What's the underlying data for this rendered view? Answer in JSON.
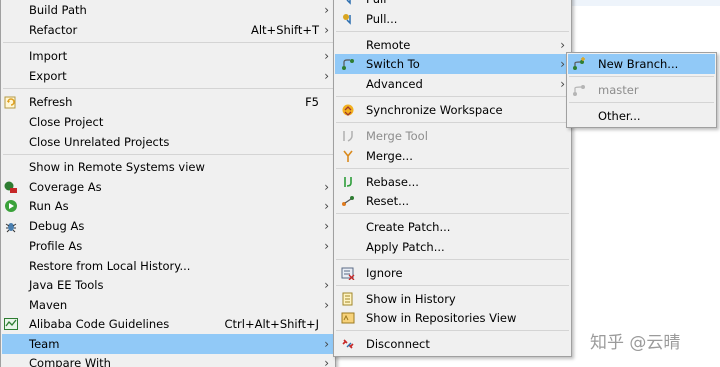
{
  "main_menu": {
    "items": [
      {
        "label": "Build Path",
        "submenu": true
      },
      {
        "label": "Refactor",
        "shortcut": "Alt+Shift+T",
        "submenu": true
      },
      {
        "label": "Import",
        "submenu": true
      },
      {
        "label": "Export",
        "submenu": true
      },
      {
        "label": "Refresh",
        "shortcut": "F5",
        "icon": "refresh-icon"
      },
      {
        "label": "Close Project"
      },
      {
        "label": "Close Unrelated Projects"
      },
      {
        "label": "Show in Remote Systems view"
      },
      {
        "label": "Coverage As",
        "submenu": true,
        "icon": "coverage-icon"
      },
      {
        "label": "Run As",
        "submenu": true,
        "icon": "run-icon"
      },
      {
        "label": "Debug As",
        "submenu": true,
        "icon": "debug-icon"
      },
      {
        "label": "Profile As",
        "submenu": true
      },
      {
        "label": "Restore from Local History..."
      },
      {
        "label": "Java EE Tools",
        "submenu": true
      },
      {
        "label": "Maven",
        "submenu": true
      },
      {
        "label": "Alibaba Code Guidelines",
        "shortcut": "Ctrl+Alt+Shift+J",
        "icon": "alibaba-guidelines-icon"
      },
      {
        "label": "Team",
        "submenu": true,
        "highlighted": true
      },
      {
        "label": "Compare With",
        "submenu": true
      }
    ]
  },
  "team_menu": {
    "items": [
      {
        "label": "Pull",
        "icon": "git-pull-icon"
      },
      {
        "label": "Pull...",
        "icon": "git-pull-dialog-icon"
      },
      {
        "label": "Remote",
        "submenu": true
      },
      {
        "label": "Switch To",
        "submenu": true,
        "highlighted": true,
        "icon": "switch-branch-icon"
      },
      {
        "label": "Advanced",
        "submenu": true
      },
      {
        "label": "Synchronize Workspace",
        "icon": "synchronize-icon"
      },
      {
        "label": "Merge Tool",
        "disabled": true,
        "icon": "merge-tool-icon"
      },
      {
        "label": "Merge...",
        "icon": "merge-icon"
      },
      {
        "label": "Rebase...",
        "icon": "rebase-icon"
      },
      {
        "label": "Reset...",
        "icon": "reset-icon"
      },
      {
        "label": "Create Patch..."
      },
      {
        "label": "Apply Patch..."
      },
      {
        "label": "Ignore",
        "icon": "ignore-icon"
      },
      {
        "label": "Show in History",
        "icon": "history-icon"
      },
      {
        "label": "Show in Repositories View",
        "icon": "repositories-icon"
      },
      {
        "label": "Disconnect",
        "icon": "disconnect-icon"
      }
    ]
  },
  "switch_menu": {
    "items": [
      {
        "label": "New Branch...",
        "highlighted": true,
        "icon": "new-branch-icon"
      },
      {
        "label": "master",
        "disabled": true,
        "icon": "branch-icon"
      },
      {
        "label": "Other..."
      }
    ]
  },
  "watermark": "知乎 @云晴",
  "colors": {
    "menu_bg": "#f0f0f0",
    "highlight": "#91c9f7",
    "disabled_text": "#8d8d8d",
    "separator": "#d4d4d4"
  }
}
